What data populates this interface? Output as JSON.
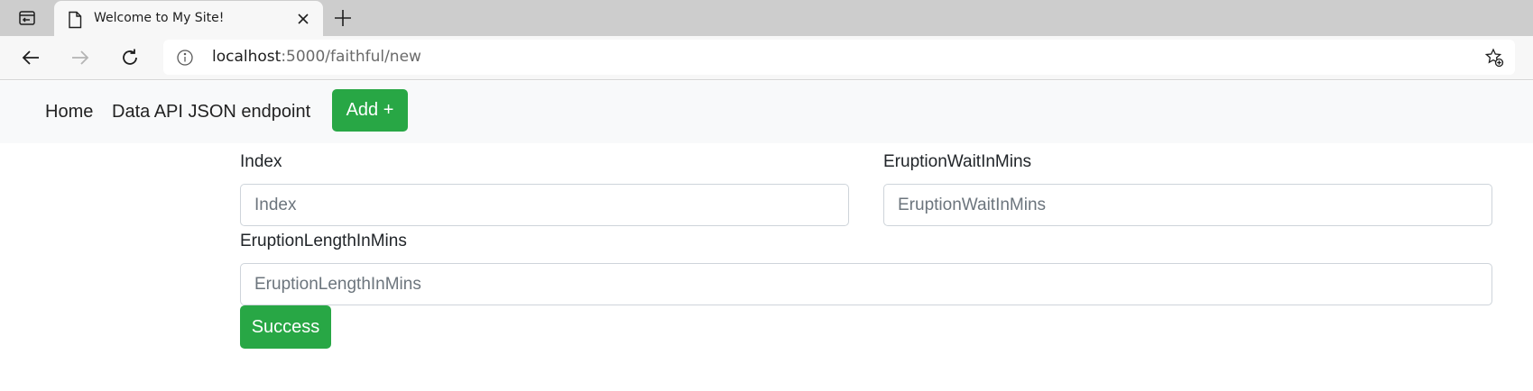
{
  "browser": {
    "tab": {
      "title": "Welcome to My Site!",
      "page_icon": "page-icon",
      "close_icon": "close-icon"
    },
    "new_tab_icon": "plus-icon",
    "address_bar": {
      "host": "localhost",
      "rest": ":5000/faithful/new",
      "info_icon": "info-icon",
      "favorite_icon": "star-add-icon"
    }
  },
  "navbar": {
    "links": {
      "home": "Home",
      "api": "Data API JSON endpoint"
    },
    "add_button": "Add +"
  },
  "form": {
    "index": {
      "label": "Index",
      "placeholder": "Index",
      "value": ""
    },
    "wait": {
      "label": "EruptionWaitInMins",
      "placeholder": "EruptionWaitInMins",
      "value": ""
    },
    "length": {
      "label": "EruptionLengthInMins",
      "placeholder": "EruptionLengthInMins",
      "value": ""
    },
    "submit": "Success"
  },
  "colors": {
    "success_green": "#28a745",
    "navbar_bg": "#f8f9fa",
    "tabstrip_bg": "#cdcdcd"
  }
}
